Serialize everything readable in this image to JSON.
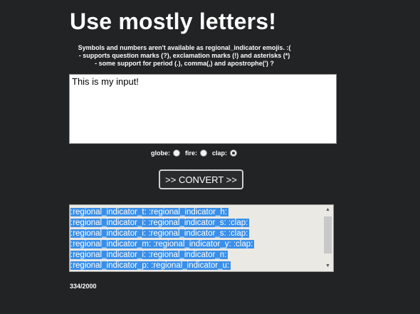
{
  "heading": "Use mostly letters!",
  "notes": [
    "Symbols and numbers aren't available as regional_indicator emojis. :(",
    "- supports question marks (?), exclamation marks (!) and asterisks (*)",
    "- some support for period (.), comma(,) and apostrophe(') ?"
  ],
  "input": {
    "value": "This is my input!"
  },
  "emoji_options": [
    {
      "label": "globe:",
      "checked": false
    },
    {
      "label": "fire:",
      "checked": false
    },
    {
      "label": "clap:",
      "checked": true
    }
  ],
  "convert_label": ">> CONVERT >>",
  "output_lines": [
    ":regional_indicator_t: :regional_indicator_h:",
    ":regional_indicator_i: :regional_indicator_s: :clap:",
    ":regional_indicator_i: :regional_indicator_s: :clap:",
    ":regional_indicator_m: :regional_indicator_y: :clap:",
    ":regional_indicator_i: :regional_indicator_n:",
    ":regional_indicator_p: :regional_indicator_u:"
  ],
  "scroll_icons": {
    "up": "scroll-up-arrow",
    "down": "scroll-down-arrow"
  },
  "counter": "334/2000",
  "colors": {
    "background": "#222324",
    "selection": "#3a8fe8",
    "output_bg": "#ebe9e4"
  }
}
